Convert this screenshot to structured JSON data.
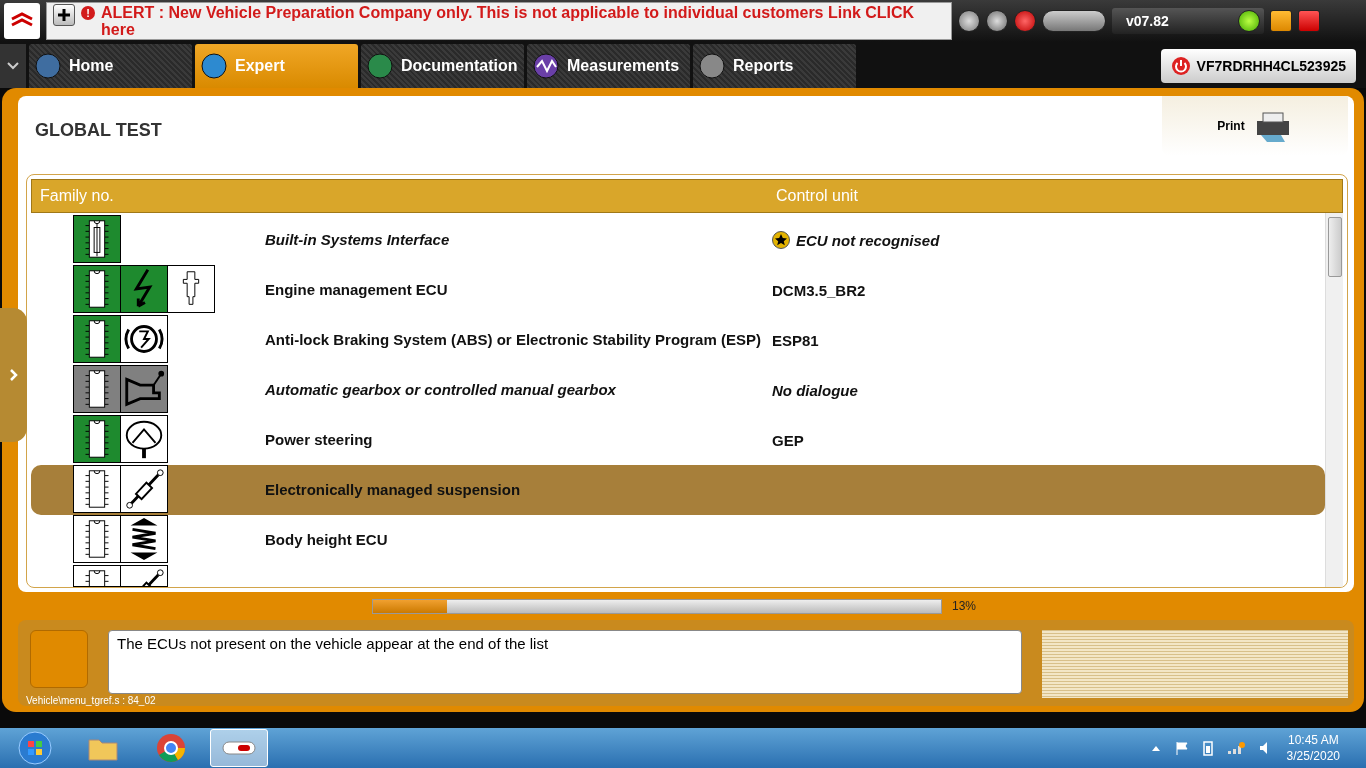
{
  "alert": {
    "icon": "!",
    "text": "ALERT : New Vehicle Preparation Company only. This is not applicable to individual customers Link CLICK here"
  },
  "version": "v07.82",
  "tabs": [
    {
      "label": "Home",
      "selected": false
    },
    {
      "label": "Expert",
      "selected": true
    },
    {
      "label": "Documentation",
      "selected": false
    },
    {
      "label": "Measurements",
      "selected": false
    },
    {
      "label": "Reports",
      "selected": false
    }
  ],
  "vin": "VF7RDRHH4CL523925",
  "page_title": "GLOBAL TEST",
  "print_label": "Print",
  "table": {
    "columns": [
      "Family no.",
      "Control unit"
    ],
    "rows": [
      {
        "tiles": [
          {
            "kind": "fuse",
            "color": "#1e8a2e"
          }
        ],
        "name": "Built-in Systems Interface",
        "italic": true,
        "unit": "ECU not recognised",
        "warning": true,
        "selected": false
      },
      {
        "tiles": [
          {
            "kind": "ecu",
            "color": "#1e8a2e"
          },
          {
            "kind": "lightning",
            "color": "#1e8a2e"
          },
          {
            "kind": "injector",
            "color": "#ffffff"
          }
        ],
        "name": "Engine management ECU",
        "italic": false,
        "unit": "DCM3.5_BR2",
        "warning": false,
        "selected": false
      },
      {
        "tiles": [
          {
            "kind": "ecu",
            "color": "#1e8a2e"
          },
          {
            "kind": "abs",
            "color": "#ffffff"
          }
        ],
        "name": "Anti-lock Braking System (ABS) or Electronic Stability Program (ESP)",
        "italic": false,
        "unit": "ESP81",
        "warning": false,
        "selected": false
      },
      {
        "tiles": [
          {
            "kind": "ecu",
            "color": "#808080"
          },
          {
            "kind": "gearbox",
            "color": "#808080"
          }
        ],
        "name": "Automatic gearbox or controlled manual gearbox",
        "italic": true,
        "unit": "No dialogue",
        "warning": false,
        "selected": false
      },
      {
        "tiles": [
          {
            "kind": "ecu",
            "color": "#1e8a2e"
          },
          {
            "kind": "steering",
            "color": "#ffffff"
          }
        ],
        "name": "Power steering",
        "italic": false,
        "unit": "GEP",
        "warning": false,
        "selected": false
      },
      {
        "tiles": [
          {
            "kind": "ecu",
            "color": "#ffffff"
          },
          {
            "kind": "suspension",
            "color": "#ffffff"
          }
        ],
        "name": "Electronically managed suspension",
        "italic": false,
        "selected": true
      },
      {
        "tiles": [
          {
            "kind": "ecu",
            "color": "#ffffff"
          },
          {
            "kind": "spring",
            "color": "#ffffff"
          }
        ],
        "name": "Body height ECU",
        "italic": false,
        "selected": false
      },
      {
        "tiles": [
          {
            "kind": "ecu",
            "color": "#ffffff"
          },
          {
            "kind": "suspension",
            "color": "#ffffff"
          }
        ],
        "selected": false
      }
    ]
  },
  "progress": {
    "level": 0.13,
    "reading": "13%"
  },
  "message": "The ECUs not present on the vehicle appear at the end of the list",
  "path": "Vehicle\\menu_tgref.s : 84_02",
  "clock": {
    "time": "10:45 AM",
    "date": "3/25/2020"
  }
}
